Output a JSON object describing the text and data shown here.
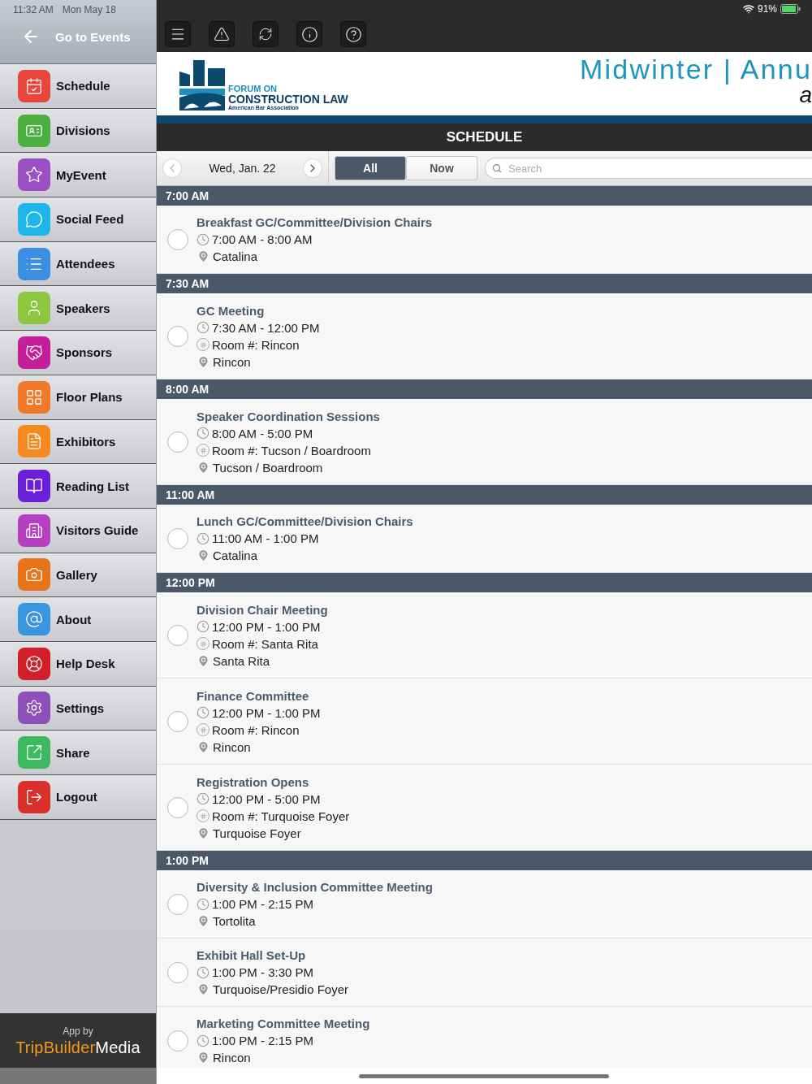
{
  "status_bar": {
    "time": "11:32 AM",
    "date": "Mon May 18",
    "battery": "91%"
  },
  "sidebar": {
    "back": "Go to Events",
    "items": [
      {
        "label": "Schedule",
        "color": "#e8453c"
      },
      {
        "label": "Divisions",
        "color": "#4caf3f"
      },
      {
        "label": "MyEvent",
        "color": "#9b4fc4"
      },
      {
        "label": "Social Feed",
        "color": "#1fb5e8"
      },
      {
        "label": "Attendees",
        "color": "#3b8ee0"
      },
      {
        "label": "Speakers",
        "color": "#8dc63f"
      },
      {
        "label": "Sponsors",
        "color": "#c61e9b"
      },
      {
        "label": "Floor Plans",
        "color": "#f0792a"
      },
      {
        "label": "Exhibitors",
        "color": "#f68a1e"
      },
      {
        "label": "Reading List",
        "color": "#6c1fd8"
      },
      {
        "label": "Visitors Guide",
        "color": "#b53fc1"
      },
      {
        "label": "Gallery",
        "color": "#e8741a"
      },
      {
        "label": "About",
        "color": "#3a95e0"
      },
      {
        "label": "Help Desk",
        "color": "#d1202a"
      },
      {
        "label": "Settings",
        "color": "#8d4fb8"
      },
      {
        "label": "Share",
        "color": "#3dba5f"
      },
      {
        "label": "Logout",
        "color": "#d9302b"
      }
    ],
    "footer": {
      "caption": "App by",
      "brand_left": "TripBuilder",
      "brand_right": "Media"
    }
  },
  "banner": {
    "logo_line1": "FORUM ON",
    "logo_line2": "CONSTRUCTION LAW",
    "logo_line3": "American Bar Association",
    "title": "Midwinter | Annu",
    "subtitle": "a"
  },
  "page_title": "SCHEDULE",
  "filter": {
    "date": "Wed, Jan. 22",
    "tabs": [
      {
        "label": "All",
        "selected": true
      },
      {
        "label": "Now",
        "selected": false
      }
    ],
    "search": {
      "placeholder": "Search"
    }
  },
  "groups": [
    {
      "time": "7:00 AM",
      "events": [
        {
          "title": "Breakfast GC/Committee/Division Chairs",
          "time": "7:00 AM - 8:00 AM",
          "location": "Catalina",
          "checked": false
        }
      ]
    },
    {
      "time": "7:30 AM",
      "events": [
        {
          "title": "GC Meeting",
          "time": "7:30 AM - 12:00 PM",
          "room": "Room #: Rincon",
          "location": "Rincon",
          "checked": false
        }
      ]
    },
    {
      "time": "8:00 AM",
      "events": [
        {
          "title": "Speaker Coordination Sessions",
          "time": "8:00 AM - 5:00 PM",
          "room": "Room #: Tucson / Boardroom",
          "location": "Tucson / Boardroom",
          "checked": false
        }
      ]
    },
    {
      "time": "11:00 AM",
      "events": [
        {
          "title": "Lunch GC/Committee/Division Chairs",
          "time": "11:00 AM - 1:00 PM",
          "location": "Catalina",
          "checked": false
        }
      ]
    },
    {
      "time": "12:00 PM",
      "events": [
        {
          "title": "Division Chair Meeting",
          "time": "12:00 PM - 1:00 PM",
          "room": "Room #: Santa Rita",
          "location": "Santa Rita",
          "checked": false
        },
        {
          "title": "Finance Committee",
          "time": "12:00 PM - 1:00 PM",
          "room": "Room #: Rincon",
          "location": "Rincon",
          "checked": false
        },
        {
          "title": "Registration Opens",
          "time": "12:00 PM - 5:00 PM",
          "room": "Room #: Turquoise Foyer",
          "location": "Turquoise Foyer",
          "checked": false
        }
      ]
    },
    {
      "time": "1:00 PM",
      "events": [
        {
          "title": "Diversity & Inclusion Committee Meeting",
          "time": "1:00 PM - 2:15 PM",
          "location": "Tortolita",
          "checked": false
        },
        {
          "title": "Exhibit Hall Set-Up",
          "time": "1:00 PM - 3:30 PM",
          "location": "Turquoise/Presidio Foyer",
          "checked": false
        },
        {
          "title": "Marketing Committee Meeting",
          "time": "1:00 PM - 2:15 PM",
          "location": "Rincon",
          "checked": false
        }
      ]
    }
  ]
}
